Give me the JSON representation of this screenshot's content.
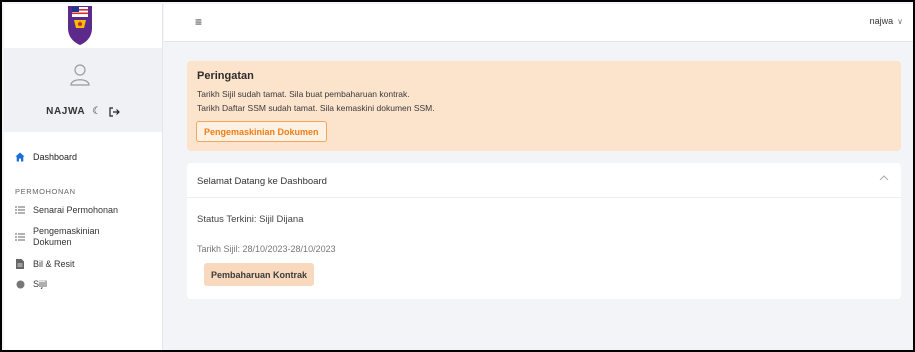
{
  "sidebar": {
    "user_name": "NAJWA",
    "icons": {
      "moon": "moon-icon",
      "logout": "logout-icon",
      "avatar": "user-icon",
      "logo": "crest-logo"
    },
    "nav": {
      "dashboard": "Dashboard",
      "section": "PERMOHONAN",
      "items": [
        {
          "label": "Senarai Permohonan",
          "icon": "list-icon"
        },
        {
          "label": "Pengemaskinian Dokumen",
          "icon": "list-icon"
        },
        {
          "label": "Bil & Resit",
          "icon": "document-icon"
        },
        {
          "label": "Sijil",
          "icon": "circle-icon"
        }
      ]
    }
  },
  "topbar": {
    "menu_icon": "≡",
    "user_label": "najwa",
    "chevron": "∨"
  },
  "alert": {
    "title": "Peringatan",
    "line1": "Tarikh Sijil sudah tamat. Sila buat pembaharuan kontrak.",
    "line2": "Tarikh Daftar SSM sudah tamat. Sila kemaskini dokumen SSM.",
    "button": "Pengemaskinian Dokumen"
  },
  "card": {
    "title": "Selamat Datang ke Dashboard",
    "status": "Status Terkini: Sijil Dijana",
    "dates": "Tarikh Sijil: 28/10/2023-28/10/2023",
    "button": "Pembaharuan Kontrak"
  },
  "colors": {
    "accent": "#ee7d16",
    "alert_bg": "#fce3cc",
    "nav_dashboard_icon": "#1d6fd8",
    "page_bg": "#f3f4f7"
  }
}
